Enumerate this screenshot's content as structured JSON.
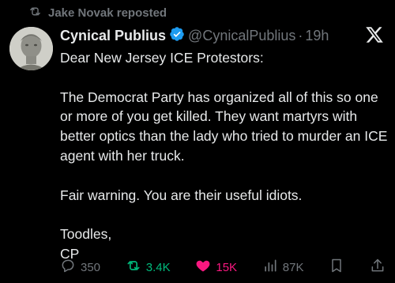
{
  "repost": {
    "icon": "repost-icon",
    "label": "Jake Novak reposted"
  },
  "author": {
    "name": "Cynical Publius",
    "handle": "@CynicalPublius",
    "separator": "·",
    "time": "19h",
    "verified_color": "#1d9bf0"
  },
  "post": {
    "paragraphs": [
      "Dear New Jersey ICE Protestors:",
      "The Democrat Party has organized all of this so one or more of you get killed.  They want martyrs with better optics than the lady who tried to murder an ICE agent with her truck.",
      "Fair warning.  You are their useful idiots.",
      "Toodles,",
      "CP"
    ]
  },
  "actions": {
    "replies": "350",
    "reposts": "3.4K",
    "likes": "15K",
    "views": "87K"
  },
  "colors": {
    "background": "#000000",
    "text": "#e7e9ea",
    "muted": "#71767b",
    "repost_active": "#00ba7c",
    "like_active": "#f91880"
  }
}
